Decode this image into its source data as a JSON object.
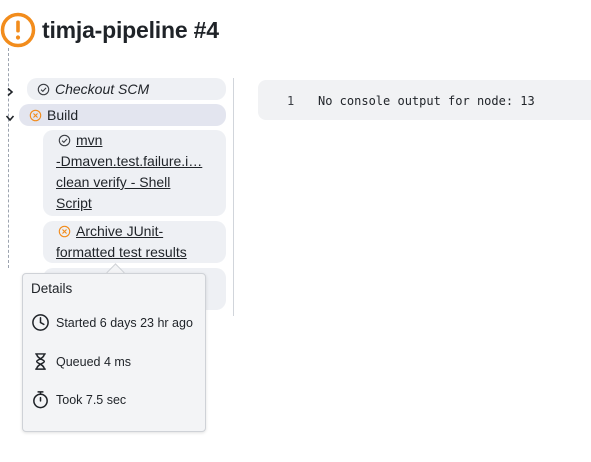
{
  "header": {
    "title": "timja-pipeline #4",
    "status_color": "#f28c1c"
  },
  "tree": {
    "nodes": [
      {
        "label": "Checkout SCM",
        "status": "success",
        "expanded": false
      },
      {
        "label": "Build",
        "status": "failed",
        "expanded": true
      }
    ],
    "steps": [
      {
        "label_lines": [
          "mvn",
          "-Dmaven.test.failure.i…",
          "clean verify - Shell",
          "Script"
        ],
        "status": "success"
      },
      {
        "label_lines": [
          "Archive JUnit-",
          "formatted test results"
        ],
        "status": "failed"
      }
    ]
  },
  "console": {
    "line_number": "1",
    "text": "No console output for node: 13"
  },
  "tooltip": {
    "title": "Details",
    "started": "Started 6 days 23 hr ago",
    "queued": "Queued 4 ms",
    "took": "Took 7.5 sec"
  },
  "colors": {
    "failed": "#f28c1c",
    "success": "#3c3f45"
  }
}
